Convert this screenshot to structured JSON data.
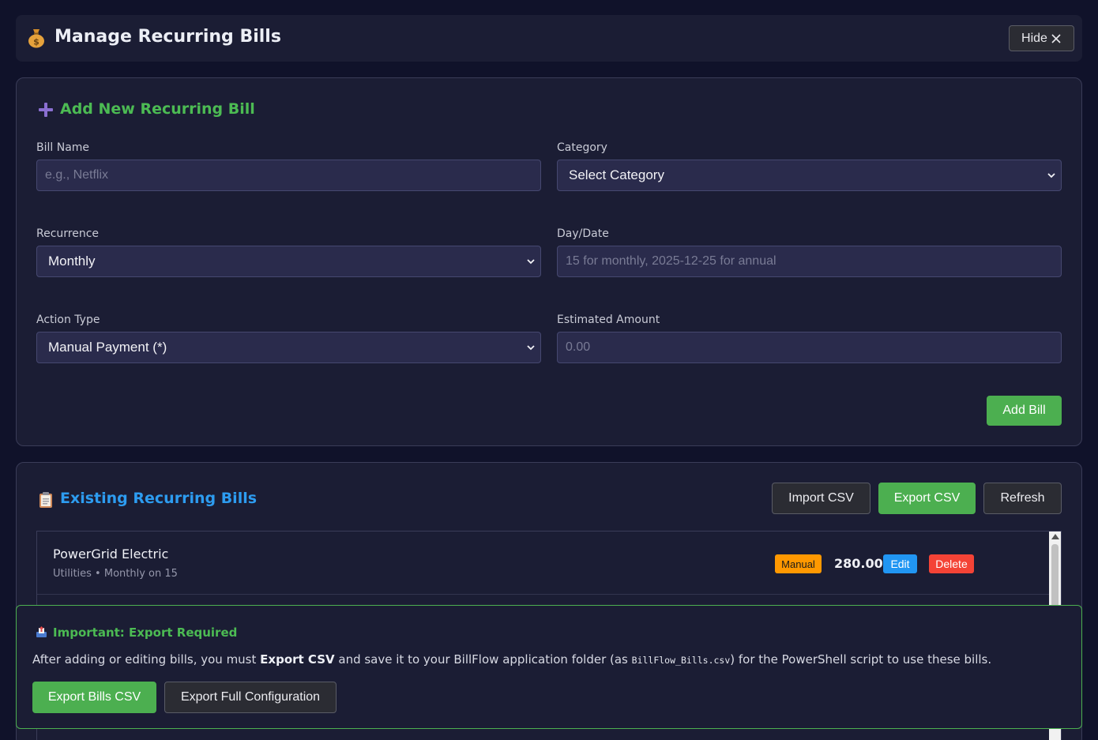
{
  "header": {
    "icon": "money-bag-icon",
    "title": "Manage Recurring Bills",
    "hide_label": "Hide"
  },
  "add_form": {
    "title": "Add New Recurring Bill",
    "bill_name": {
      "label": "Bill Name",
      "placeholder": "e.g., Netflix"
    },
    "category": {
      "label": "Category",
      "value": "Select Category"
    },
    "recurrence": {
      "label": "Recurrence",
      "value": "Monthly"
    },
    "day_date": {
      "label": "Day/Date",
      "placeholder": "15 for monthly, 2025-12-25 for annual"
    },
    "action_type": {
      "label": "Action Type",
      "value": "Manual Payment (*)"
    },
    "estimated_amount": {
      "label": "Estimated Amount",
      "placeholder": "0.00"
    },
    "submit_label": "Add Bill"
  },
  "existing": {
    "title": "Existing Recurring Bills",
    "import_label": "Import CSV",
    "export_label": "Export CSV",
    "refresh_label": "Refresh",
    "bills": [
      {
        "name": "PowerGrid Electric",
        "meta": "Utilities • Monthly on 15",
        "type_badge": "Manual",
        "amount": "280.00",
        "edit_label": "Edit",
        "delete_label": "Delete"
      }
    ]
  },
  "notice": {
    "title": "Important: Export Required",
    "text_pre": "After adding or editing bills, you must ",
    "text_bold": "Export CSV",
    "text_mid": " and save it to your BillFlow application folder (as ",
    "text_code": "BillFlow_Bills.csv",
    "text_post": ") for the PowerShell script to use these bills.",
    "export_bills_label": "Export Bills CSV",
    "export_config_label": "Export Full Configuration"
  },
  "colors": {
    "background": "#10122a",
    "panel": "#1b1d34",
    "accent_green": "#4caf50",
    "accent_blue": "#2196f3",
    "accent_orange": "#ff9800",
    "accent_red": "#f44336"
  }
}
